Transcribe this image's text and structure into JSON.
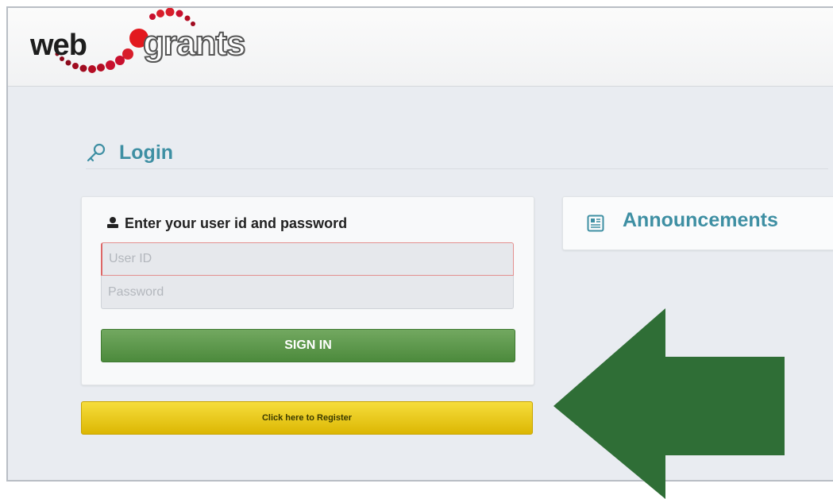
{
  "logo": {
    "web": "web",
    "grants": "grants"
  },
  "login": {
    "title": "Login",
    "instruction": "Enter your user id and password",
    "user_placeholder": "User ID",
    "password_placeholder": "Password",
    "signin_label": "SIGN IN"
  },
  "register": {
    "label": "Click here to Register"
  },
  "announcements": {
    "title": "Announcements"
  },
  "colors": {
    "accent": "#3e8fa3",
    "signin": "#5a9648",
    "register": "#e8c61c",
    "arrow": "#2f6e36"
  }
}
